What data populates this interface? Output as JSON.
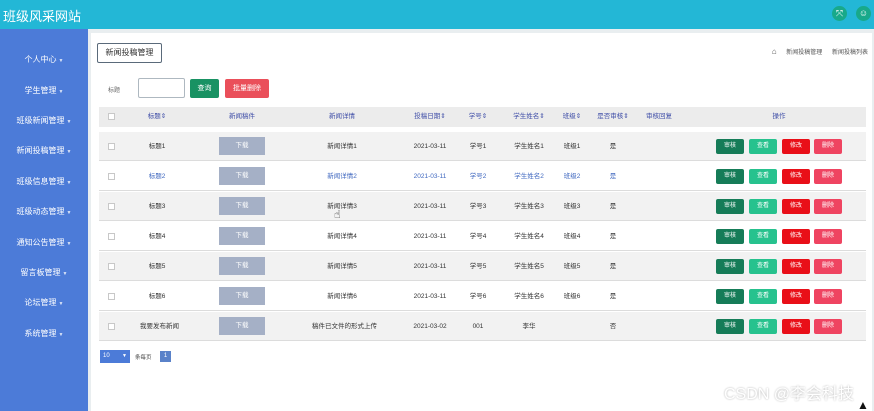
{
  "app": {
    "title": "班级风采网站",
    "icons": [
      "fullscreen-icon",
      "user-icon"
    ]
  },
  "sidebar": {
    "items": [
      {
        "label": "个人中心"
      },
      {
        "label": "学生管理"
      },
      {
        "label": "班级新闻管理"
      },
      {
        "label": "新闻投稿管理"
      },
      {
        "label": "班级信息管理"
      },
      {
        "label": "班级动态管理"
      },
      {
        "label": "通知公告管理"
      },
      {
        "label": "留言板管理"
      },
      {
        "label": "论坛管理"
      },
      {
        "label": "系统管理"
      }
    ]
  },
  "page": {
    "tab_label": "新闻投稿管理",
    "breadcrumb": [
      "新闻投稿管理",
      "新闻投稿列表"
    ]
  },
  "filter": {
    "label": "标题",
    "value": "",
    "search_label": "查询",
    "batch_delete_label": "批量删除"
  },
  "table": {
    "headers": [
      "标题",
      "新闻稿件",
      "新闻详情",
      "投稿日期",
      "学号",
      "学生姓名",
      "班级",
      "是否审核",
      "审核回复",
      "操作"
    ],
    "header_sort": "⇕",
    "download_label": "下载",
    "action_labels": {
      "review": "审核",
      "view": "查看",
      "edit": "修改",
      "delete": "删除"
    },
    "rows": [
      {
        "title": "标题1",
        "detail": "新闻详情1",
        "date": "2021-03-11",
        "student_no": "学号1",
        "student_name": "学生姓名1",
        "class": "班级1",
        "reviewed": "是",
        "reply": ""
      },
      {
        "title": "标题2",
        "detail": "新闻详情2",
        "date": "2021-03-11",
        "student_no": "学号2",
        "student_name": "学生姓名2",
        "class": "班级2",
        "reviewed": "是",
        "reply": ""
      },
      {
        "title": "标题3",
        "detail": "新闻详情3",
        "date": "2021-03-11",
        "student_no": "学号3",
        "student_name": "学生姓名3",
        "class": "班级3",
        "reviewed": "是",
        "reply": ""
      },
      {
        "title": "标题4",
        "detail": "新闻详情4",
        "date": "2021-03-11",
        "student_no": "学号4",
        "student_name": "学生姓名4",
        "class": "班级4",
        "reviewed": "是",
        "reply": ""
      },
      {
        "title": "标题5",
        "detail": "新闻详情5",
        "date": "2021-03-11",
        "student_no": "学号5",
        "student_name": "学生姓名5",
        "class": "班级5",
        "reviewed": "是",
        "reply": ""
      },
      {
        "title": "标题6",
        "detail": "新闻详情6",
        "date": "2021-03-11",
        "student_no": "学号6",
        "student_name": "学生姓名6",
        "class": "班级6",
        "reviewed": "是",
        "reply": ""
      },
      {
        "title": "我要发布新闻",
        "detail": "稿件已文件的形式上传",
        "date": "2021-03-02",
        "student_no": "001",
        "student_name": "李华",
        "class": "",
        "reviewed": "否",
        "reply": ""
      }
    ]
  },
  "pager": {
    "page_size": "10",
    "info": "条每页",
    "current_page": "1"
  },
  "watermark": "CSDN @李会科技",
  "colors": {
    "topbar": "#23b7d6",
    "sidebar": "#4c7bd8",
    "review": "#167c58",
    "view": "#27c28e",
    "edit": "#e90f18",
    "delete": "#ef4461"
  }
}
